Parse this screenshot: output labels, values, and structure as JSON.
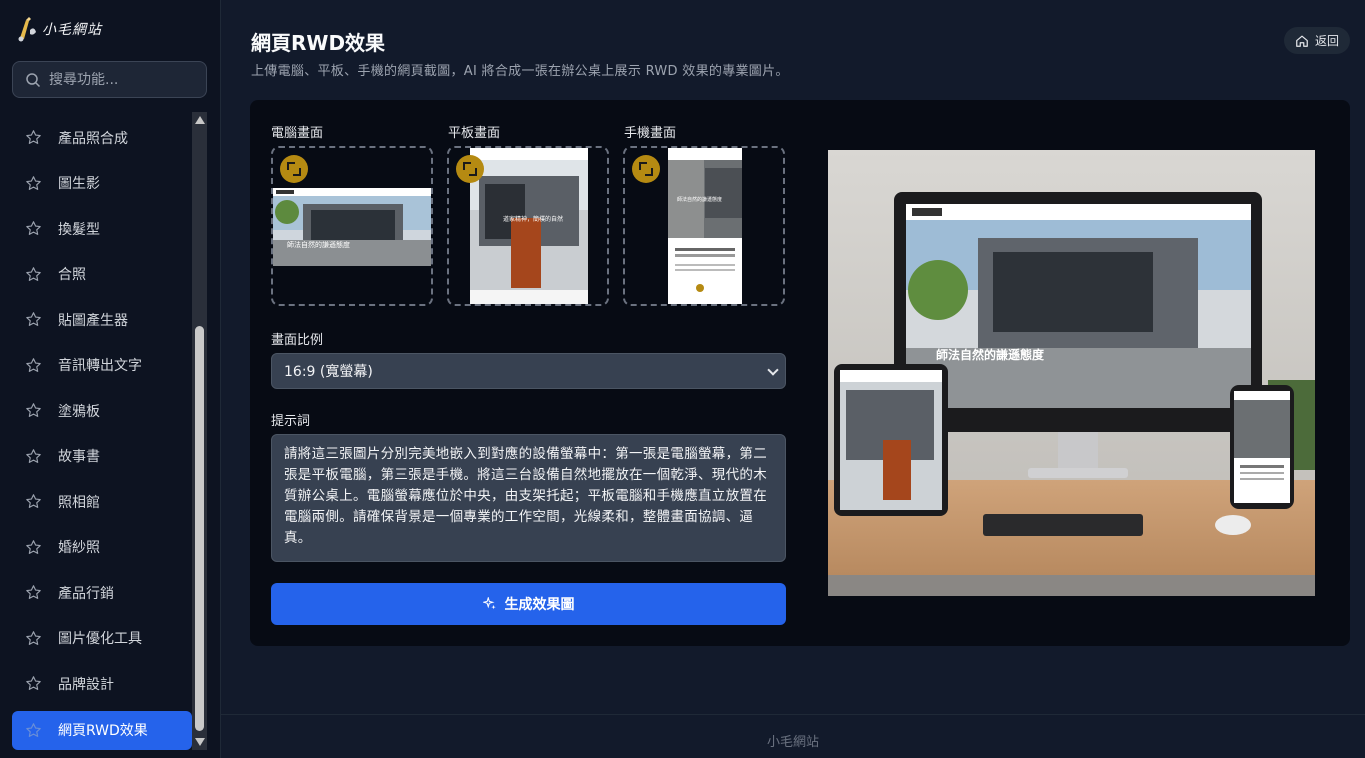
{
  "app": {
    "logo_text": "小毛網站"
  },
  "search": {
    "placeholder": "搜尋功能..."
  },
  "sidebar": {
    "items": [
      {
        "label": "產品照合成"
      },
      {
        "label": "圖生影"
      },
      {
        "label": "換髮型"
      },
      {
        "label": "合照"
      },
      {
        "label": "貼圖產生器"
      },
      {
        "label": "音訊轉出文字"
      },
      {
        "label": "塗鴉板"
      },
      {
        "label": "故事書"
      },
      {
        "label": "照相館"
      },
      {
        "label": "婚紗照"
      },
      {
        "label": "產品行銷"
      },
      {
        "label": "圖片優化工具"
      },
      {
        "label": "品牌設計"
      },
      {
        "label": "網頁RWD效果",
        "active": true
      }
    ]
  },
  "page": {
    "title": "網頁RWD效果",
    "subtitle": "上傳電腦、平板、手機的網頁截圖，AI 將合成一張在辦公桌上展示 RWD 效果的專業圖片。",
    "back_label": "返回"
  },
  "uploads": {
    "desktop_label": "電腦畫面",
    "tablet_label": "平板畫面",
    "phone_label": "手機畫面",
    "desktop_caption": "師法自然的謙遜態度",
    "tablet_caption": "道家精神，簡樸的自然",
    "phone_caption": "師法自然的謙遜態度"
  },
  "ratio": {
    "label": "畫面比例",
    "value": "16:9 (寬螢幕)"
  },
  "prompt": {
    "label": "提示詞",
    "value": "請將這三張圖片分別完美地嵌入到對應的設備螢幕中：第一張是電腦螢幕，第二張是平板電腦，第三張是手機。將這三台設備自然地擺放在一個乾淨、現代的木質辦公桌上。電腦螢幕應位於中央，由支架托起；平板電腦和手機應直立放置在電腦兩側。請確保背景是一個專業的工作空間，光線柔和，整體畫面協調、逼真。"
  },
  "generate": {
    "label": "生成效果圖"
  },
  "result": {
    "screen_caption": "師法自然的謙遜態度"
  },
  "footer": {
    "text": "小毛網站"
  },
  "colors": {
    "accent": "#2563eb",
    "badge": "#b58a12",
    "background": "#121a2b",
    "panel": "#070b14"
  }
}
